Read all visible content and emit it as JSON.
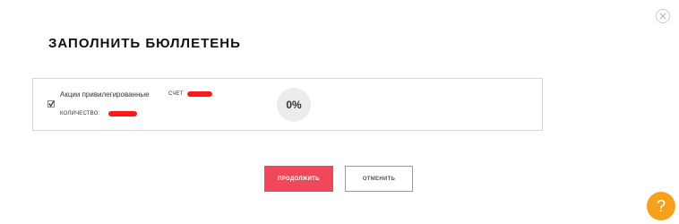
{
  "dialog": {
    "title": "ЗАПОЛНИТЬ БЮЛЛЕТЕНЬ",
    "close_icon": "close-icon"
  },
  "ballot": {
    "checked": true,
    "security_name": "Акции привилегированные",
    "account_label": "СЧЕТ",
    "quantity_label": "КОЛИЧЕСТВО:",
    "progress_text": "0%",
    "progress_value": 0
  },
  "actions": {
    "continue_label": "ПРОДОЛЖИТЬ",
    "cancel_label": "ОТМЕНИТЬ"
  },
  "help": {
    "label": "?"
  },
  "colors": {
    "accent": "#f0475a",
    "help": "#f6a11e",
    "redaction": "#ff1a1a"
  }
}
